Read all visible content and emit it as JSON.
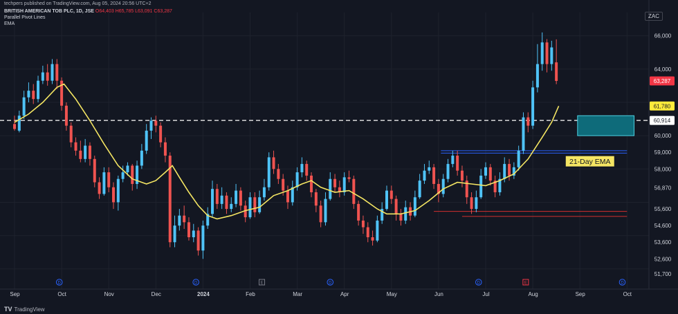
{
  "header": {
    "published": "techpers published on TradingView.com, Aug 05, 2024 20:56 UTC+2",
    "symbol": "BRITISH AMERICAN TOB PLC, 1D, JSE",
    "o_label": "O",
    "o_value": "64,403",
    "h_label": "H",
    "h_value": "65,785",
    "l_label": "L",
    "l_value": "63,091",
    "c_label": "C",
    "c_value": "63,287",
    "indicator_1": "Parallel Pivot Lines",
    "indicator_2": "EMA"
  },
  "currency": "ZAC",
  "footer": {
    "brand_mark": "TV",
    "brand": "TradingView"
  },
  "colors": {
    "bg": "#131722",
    "up": "#26a69a",
    "up_bright": "#4fc3f7",
    "down": "#ef5350",
    "ema": "#f5e663",
    "grid": "#1e222d",
    "text": "#d1d4dc",
    "blue_line": "#2962ff",
    "red_line": "#d32f2f",
    "box": "#0e6b7a"
  },
  "chart_data": {
    "type": "candlestick",
    "x_labels": [
      "Sep",
      "Oct",
      "Nov",
      "Dec",
      "2024",
      "Feb",
      "Mar",
      "Apr",
      "May",
      "Jun",
      "Jul",
      "Aug",
      "Sep",
      "Oct"
    ],
    "y_ticks": [
      66000,
      64000,
      61780,
      63287,
      60914,
      60000,
      59000,
      58000,
      56870,
      55600,
      54600,
      53600,
      52600,
      51700
    ],
    "y_tick_labels": [
      "66,000",
      "64,000",
      "61,780",
      "63,287",
      "60,914",
      "60,000",
      "59,000",
      "58,000",
      "56,870",
      "55,600",
      "54,600",
      "53,600",
      "52,600",
      "51,700"
    ],
    "ylim": [
      51200,
      67400
    ],
    "price_labels": [
      {
        "value": 63287,
        "label": "63,287",
        "kind": "last"
      },
      {
        "value": 61780,
        "label": "61,780",
        "kind": "ema"
      },
      {
        "value": 60914,
        "label": "60,914",
        "kind": "level"
      }
    ],
    "dashed_level": 60914,
    "annotation": "21-Day EMA",
    "event_markers": [
      {
        "month_index": 0.95,
        "letter": "D"
      },
      {
        "month_index": 3.85,
        "letter": "D"
      },
      {
        "month_index": 5.25,
        "letter": "E"
      },
      {
        "month_index": 6.7,
        "letter": "D"
      },
      {
        "month_index": 9.85,
        "letter": "D"
      },
      {
        "month_index": 10.85,
        "letter": "E"
      },
      {
        "month_index": 12.9,
        "letter": "D"
      }
    ],
    "candles": [
      [
        0.0,
        60700,
        60400,
        61200,
        60300
      ],
      [
        0.1,
        60300,
        61200,
        61500,
        60200
      ],
      [
        0.2,
        61200,
        62300,
        62700,
        61000
      ],
      [
        0.3,
        62300,
        62700,
        63200,
        62000
      ],
      [
        0.4,
        62700,
        62200,
        63100,
        61900
      ],
      [
        0.5,
        62200,
        63300,
        63600,
        62000
      ],
      [
        0.6,
        63300,
        63800,
        64200,
        63100
      ],
      [
        0.7,
        63800,
        63300,
        64300,
        63000
      ],
      [
        0.8,
        63300,
        64300,
        64600,
        63100
      ],
      [
        0.9,
        64300,
        63300,
        64600,
        62800
      ],
      [
        1.0,
        63300,
        61800,
        63500,
        61500
      ],
      [
        1.1,
        61800,
        60600,
        62000,
        60300
      ],
      [
        1.2,
        60600,
        59600,
        60800,
        59300
      ],
      [
        1.3,
        59600,
        59100,
        59900,
        58800
      ],
      [
        1.4,
        59100,
        58600,
        59700,
        58400
      ],
      [
        1.5,
        58600,
        59400,
        59800,
        58400
      ],
      [
        1.6,
        59400,
        58600,
        59600,
        58200
      ],
      [
        1.7,
        58600,
        57200,
        58800,
        56900
      ],
      [
        1.8,
        57200,
        56500,
        57500,
        56200
      ],
      [
        1.9,
        56500,
        57800,
        58100,
        56400
      ],
      [
        2.0,
        57800,
        56900,
        58100,
        56600
      ],
      [
        2.1,
        56900,
        56000,
        57200,
        55600
      ],
      [
        2.2,
        56000,
        57400,
        57600,
        55500
      ],
      [
        2.3,
        57400,
        57800,
        58200,
        57200
      ],
      [
        2.4,
        57800,
        58200,
        58400,
        57600
      ],
      [
        2.5,
        58200,
        57100,
        58300,
        56700
      ],
      [
        2.6,
        57100,
        58200,
        58500,
        56800
      ],
      [
        2.7,
        58200,
        59100,
        59500,
        58000
      ],
      [
        2.8,
        59100,
        60300,
        60700,
        58900
      ],
      [
        2.9,
        60300,
        60900,
        61100,
        59800
      ],
      [
        3.0,
        60900,
        60600,
        61200,
        60200
      ],
      [
        3.1,
        60600,
        59600,
        60800,
        59300
      ],
      [
        3.2,
        59600,
        58800,
        59900,
        58400
      ],
      [
        3.3,
        58800,
        53600,
        59000,
        53300
      ],
      [
        3.4,
        53600,
        54600,
        55200,
        53300
      ],
      [
        3.5,
        54600,
        55200,
        55600,
        54300
      ],
      [
        3.6,
        55200,
        54800,
        55800,
        54400
      ],
      [
        3.7,
        54800,
        53900,
        55100,
        53700
      ],
      [
        3.8,
        53900,
        54300,
        54700,
        53600
      ],
      [
        3.9,
        54300,
        53100,
        54500,
        52800
      ],
      [
        4.0,
        53100,
        54600,
        54900,
        52600
      ],
      [
        4.1,
        54600,
        55300,
        55700,
        54400
      ],
      [
        4.2,
        55300,
        56800,
        57300,
        55100
      ],
      [
        4.3,
        56800,
        55900,
        57100,
        55600
      ],
      [
        4.4,
        55900,
        56400,
        56900,
        55600
      ],
      [
        4.5,
        56400,
        55600,
        56600,
        55300
      ],
      [
        4.6,
        55600,
        55900,
        56300,
        55400
      ],
      [
        4.7,
        55900,
        56700,
        57100,
        55700
      ],
      [
        4.8,
        56700,
        55800,
        56900,
        55500
      ],
      [
        4.9,
        55800,
        55100,
        56100,
        54800
      ],
      [
        5.0,
        55100,
        56300,
        56600,
        55000
      ],
      [
        5.1,
        56300,
        55400,
        56600,
        55100
      ],
      [
        5.2,
        55400,
        56300,
        56700,
        55300
      ],
      [
        5.3,
        56300,
        56900,
        57400,
        56100
      ],
      [
        5.4,
        56900,
        58700,
        59000,
        56700
      ],
      [
        5.5,
        58700,
        58000,
        59100,
        57700
      ],
      [
        5.6,
        58000,
        57400,
        58300,
        57100
      ],
      [
        5.7,
        57400,
        56700,
        57700,
        56400
      ],
      [
        5.8,
        56700,
        56000,
        57000,
        55600
      ],
      [
        5.9,
        56000,
        56900,
        57300,
        55800
      ],
      [
        6.0,
        56900,
        57800,
        58100,
        56700
      ],
      [
        6.1,
        57800,
        58300,
        58700,
        57500
      ],
      [
        6.2,
        58300,
        57600,
        58500,
        57300
      ],
      [
        6.3,
        57600,
        56600,
        57800,
        56300
      ],
      [
        6.4,
        56600,
        55800,
        56800,
        55400
      ],
      [
        6.5,
        55800,
        54800,
        56100,
        54500
      ],
      [
        6.6,
        54800,
        56200,
        56600,
        54600
      ],
      [
        6.7,
        56200,
        57400,
        57800,
        56100
      ],
      [
        6.8,
        57400,
        56900,
        57700,
        56600
      ],
      [
        6.9,
        56900,
        56600,
        57300,
        56300
      ],
      [
        7.0,
        56600,
        57500,
        57800,
        56400
      ],
      [
        7.1,
        57500,
        57400,
        57900,
        57200
      ],
      [
        7.2,
        57400,
        55900,
        57600,
        55600
      ],
      [
        7.3,
        55900,
        54900,
        56100,
        54600
      ],
      [
        7.4,
        54900,
        54500,
        55200,
        54100
      ],
      [
        7.5,
        54500,
        53900,
        54800,
        53600
      ],
      [
        7.6,
        53900,
        53700,
        54300,
        53400
      ],
      [
        7.7,
        53700,
        54900,
        55200,
        53600
      ],
      [
        7.8,
        54900,
        55600,
        56000,
        54700
      ],
      [
        7.9,
        55600,
        56700,
        57000,
        55500
      ],
      [
        8.0,
        56700,
        56200,
        57000,
        55900
      ],
      [
        8.1,
        56200,
        55300,
        56400,
        54900
      ],
      [
        8.2,
        55300,
        54900,
        55600,
        54600
      ],
      [
        8.3,
        54900,
        55700,
        56100,
        54700
      ],
      [
        8.4,
        55700,
        55200,
        56000,
        54900
      ],
      [
        8.5,
        55200,
        56300,
        56700,
        55100
      ],
      [
        8.6,
        56300,
        57300,
        57700,
        56200
      ],
      [
        8.7,
        57300,
        57900,
        58300,
        57100
      ],
      [
        8.8,
        57900,
        58100,
        58500,
        57700
      ],
      [
        8.9,
        58100,
        57100,
        58300,
        56800
      ],
      [
        9.0,
        57100,
        56500,
        57400,
        56000
      ],
      [
        9.1,
        56500,
        57400,
        57700,
        56300
      ],
      [
        9.2,
        57400,
        58300,
        58600,
        57200
      ],
      [
        9.3,
        58300,
        58800,
        59100,
        58100
      ],
      [
        9.4,
        58800,
        57900,
        59100,
        57600
      ],
      [
        9.5,
        57900,
        57300,
        58200,
        56900
      ],
      [
        9.6,
        57300,
        56300,
        57600,
        55900
      ],
      [
        9.7,
        56300,
        55600,
        56600,
        55300
      ],
      [
        9.8,
        55600,
        56300,
        56700,
        55400
      ],
      [
        9.9,
        56300,
        57600,
        58000,
        56200
      ],
      [
        10.0,
        57600,
        58100,
        58400,
        57400
      ],
      [
        10.1,
        58100,
        57300,
        58300,
        57000
      ],
      [
        10.2,
        57300,
        56600,
        57600,
        56300
      ],
      [
        10.3,
        56600,
        57400,
        57800,
        56400
      ],
      [
        10.4,
        57400,
        58300,
        58700,
        57200
      ],
      [
        10.5,
        58300,
        57600,
        58600,
        57300
      ],
      [
        10.6,
        57600,
        58100,
        58400,
        57400
      ],
      [
        10.7,
        58100,
        59100,
        59400,
        57900
      ],
      [
        10.8,
        59100,
        61100,
        61400,
        58900
      ],
      [
        10.9,
        61100,
        60600,
        61400,
        60200
      ],
      [
        11.0,
        60600,
        62900,
        63300,
        60400
      ],
      [
        11.1,
        62900,
        64300,
        65500,
        62600
      ],
      [
        11.2,
        64300,
        65600,
        66200,
        63900
      ],
      [
        11.3,
        65600,
        64300,
        65800,
        63800
      ],
      [
        11.4,
        64300,
        65300,
        65700,
        63900
      ],
      [
        11.5,
        64403,
        63287,
        65785,
        63091
      ]
    ],
    "ema": [
      [
        0.0,
        60800
      ],
      [
        0.3,
        61300
      ],
      [
        0.6,
        62000
      ],
      [
        0.9,
        62900
      ],
      [
        1.05,
        63100
      ],
      [
        1.3,
        62200
      ],
      [
        1.6,
        60900
      ],
      [
        1.9,
        59500
      ],
      [
        2.2,
        58200
      ],
      [
        2.5,
        57400
      ],
      [
        2.8,
        57100
      ],
      [
        3.0,
        57300
      ],
      [
        3.2,
        57800
      ],
      [
        3.35,
        58200
      ],
      [
        3.5,
        57500
      ],
      [
        3.7,
        56600
      ],
      [
        3.9,
        55800
      ],
      [
        4.1,
        55200
      ],
      [
        4.3,
        55000
      ],
      [
        4.6,
        55200
      ],
      [
        4.9,
        55500
      ],
      [
        5.2,
        55700
      ],
      [
        5.5,
        56400
      ],
      [
        5.8,
        56700
      ],
      [
        6.1,
        57100
      ],
      [
        6.3,
        57300
      ],
      [
        6.5,
        56900
      ],
      [
        6.8,
        56600
      ],
      [
        7.1,
        56700
      ],
      [
        7.4,
        56200
      ],
      [
        7.7,
        55600
      ],
      [
        7.9,
        55300
      ],
      [
        8.2,
        55300
      ],
      [
        8.5,
        55500
      ],
      [
        8.8,
        56100
      ],
      [
        9.1,
        56800
      ],
      [
        9.4,
        57200
      ],
      [
        9.7,
        57100
      ],
      [
        10.0,
        57000
      ],
      [
        10.3,
        57300
      ],
      [
        10.6,
        57700
      ],
      [
        10.9,
        58600
      ],
      [
        11.2,
        59900
      ],
      [
        11.4,
        60800
      ],
      [
        11.55,
        61780
      ]
    ],
    "pivot_lines": [
      {
        "from": 9.05,
        "to": 13.0,
        "value": 59100,
        "color": "blue"
      },
      {
        "from": 9.05,
        "to": 13.0,
        "value": 58950,
        "color": "blue"
      },
      {
        "from": 8.9,
        "to": 13.0,
        "value": 55450,
        "color": "red"
      },
      {
        "from": 9.5,
        "to": 13.0,
        "value": 55150,
        "color": "red"
      }
    ]
  }
}
